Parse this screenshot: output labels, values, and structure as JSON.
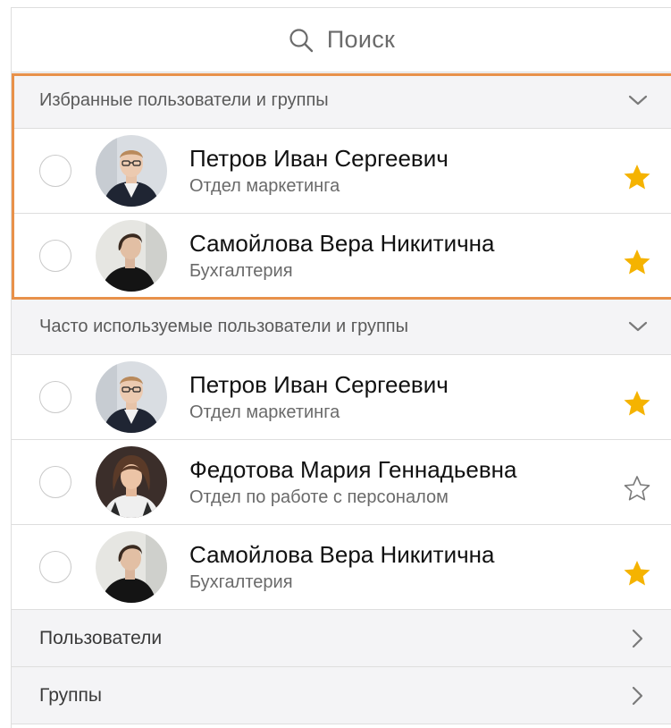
{
  "search": {
    "label": "Поиск",
    "icon": "search-icon"
  },
  "favorites": {
    "title": "Избранные пользователи и группы",
    "items": [
      {
        "name": "Петров Иван Сергеевич",
        "dept": "Отдел маркетинга",
        "starred": true
      },
      {
        "name": "Самойлова Вера Никитична",
        "dept": "Бухгалтерия",
        "starred": true
      }
    ]
  },
  "frequent": {
    "title": "Часто используемые пользователи и группы",
    "items": [
      {
        "name": "Петров Иван Сергеевич",
        "dept": "Отдел маркетинга",
        "starred": true
      },
      {
        "name": "Федотова Мария Геннадьевна",
        "dept": "Отдел по работе с персоналом",
        "starred": false
      },
      {
        "name": "Самойлова Вера Никитична",
        "dept": "Бухгалтерия",
        "starred": true
      }
    ]
  },
  "nav": {
    "users": "Пользователи",
    "groups": "Группы"
  },
  "colors": {
    "accent": "#e8914a",
    "star": "#f5b301",
    "section_bg": "#f4f4f6"
  }
}
